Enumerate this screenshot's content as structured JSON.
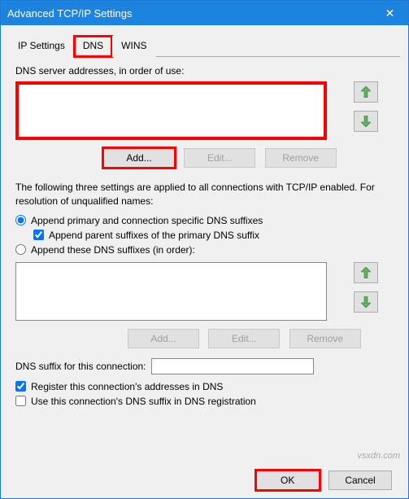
{
  "window": {
    "title": "Advanced TCP/IP Settings"
  },
  "tabs": {
    "ip": "IP Settings",
    "dns": "DNS",
    "wins": "WINS"
  },
  "dnsPanel": {
    "serversLabel": "DNS server addresses, in order of use:",
    "add": "Add...",
    "edit": "Edit...",
    "remove": "Remove",
    "desc": "The following three settings are applied to all connections with TCP/IP enabled. For resolution of unqualified names:",
    "radio1": "Append primary and connection specific DNS suffixes",
    "check1": "Append parent suffixes of the primary DNS suffix",
    "radio2": "Append these DNS suffixes (in order):",
    "add2": "Add...",
    "edit2": "Edit...",
    "remove2": "Remove",
    "suffixLabel": "DNS suffix for this connection:",
    "suffixValue": "",
    "registerCheck": "Register this connection's addresses in DNS",
    "useSuffixCheck": "Use this connection's DNS suffix in DNS registration"
  },
  "buttons": {
    "ok": "OK",
    "cancel": "Cancel"
  },
  "watermark": "vsxdn.com"
}
